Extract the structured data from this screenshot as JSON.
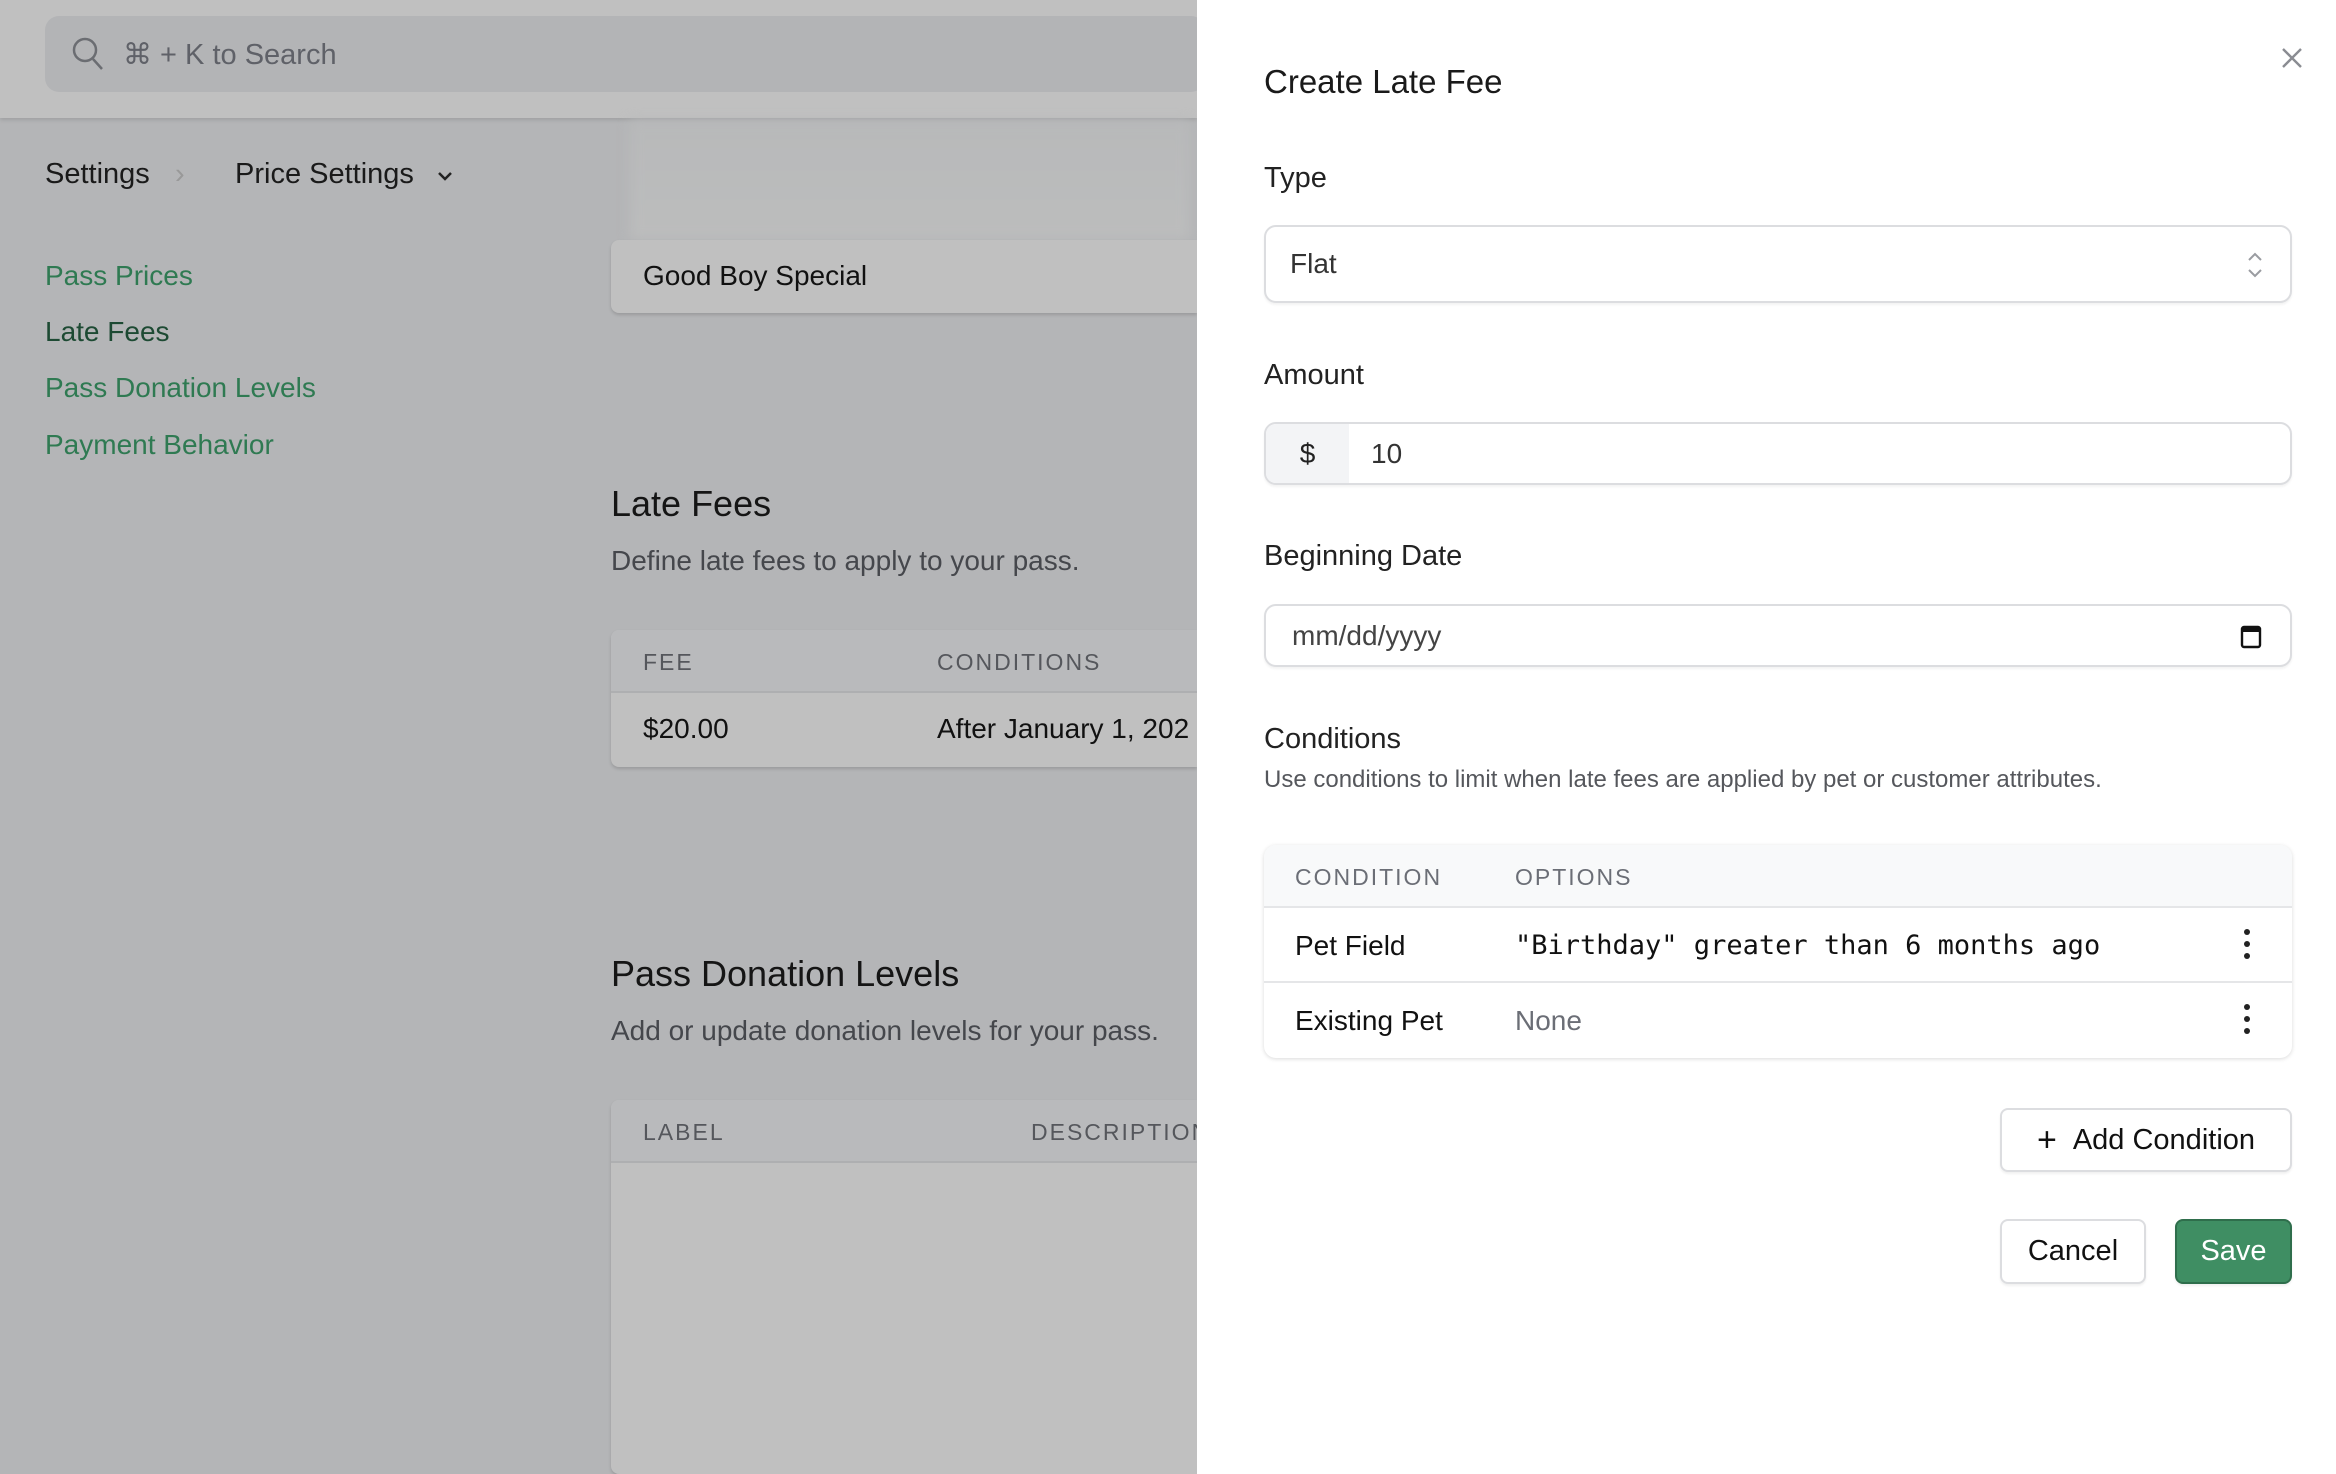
{
  "header": {
    "search_placeholder": "⌘ + K to Search"
  },
  "breadcrumb": {
    "root": "Settings",
    "current": "Price Settings"
  },
  "sidebar": {
    "items": [
      {
        "label": "Pass Prices"
      },
      {
        "label": "Late Fees"
      },
      {
        "label": "Pass Donation Levels"
      },
      {
        "label": "Payment Behavior"
      }
    ]
  },
  "main": {
    "pass_prices_row": "Good Boy Special",
    "late_fees": {
      "title": "Late Fees",
      "description": "Define late fees to apply to your pass.",
      "columns": [
        "FEE",
        "CONDITIONS"
      ],
      "rows": [
        {
          "fee": "$20.00",
          "conditions": "After January 1, 202"
        }
      ]
    },
    "donation_levels": {
      "title": "Pass Donation Levels",
      "description": "Add or update donation levels for your pass.",
      "columns": [
        "LABEL",
        "DESCRIPTION"
      ]
    }
  },
  "modal": {
    "title": "Create Late Fee",
    "type": {
      "label": "Type",
      "value": "Flat"
    },
    "amount": {
      "label": "Amount",
      "prefix": "$",
      "value": "10"
    },
    "beginning_date": {
      "label": "Beginning Date",
      "placeholder": "mm/dd/yyyy"
    },
    "conditions": {
      "title": "Conditions",
      "description": "Use conditions to limit when late fees are applied by pet or customer attributes.",
      "columns": [
        "CONDITION",
        "OPTIONS"
      ],
      "rows": [
        {
          "condition": "Pet Field",
          "options": "\"Birthday\" greater than 6 months ago"
        },
        {
          "condition": "Existing Pet",
          "options": "None"
        }
      ]
    },
    "add_condition": "Add Condition",
    "cancel": "Cancel",
    "save": "Save",
    "accent": "#3f8e63"
  }
}
